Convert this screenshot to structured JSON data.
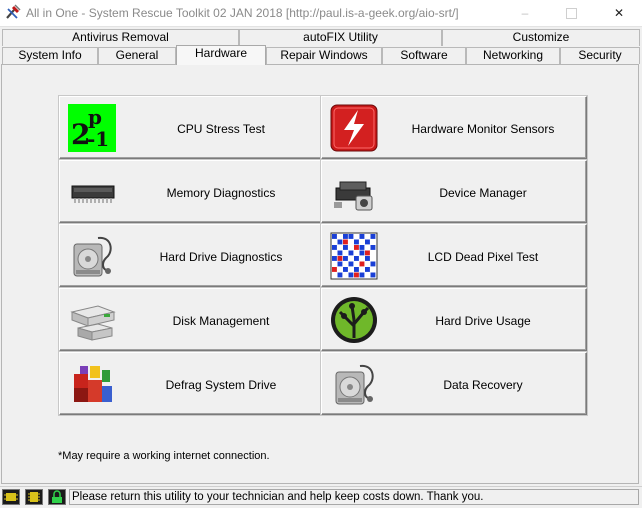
{
  "window": {
    "title": "All in One - System Rescue Toolkit 02 JAN 2018 [http://paul.is-a-geek.org/aio-srt/]",
    "controls": {
      "minimize": "–",
      "maximize": "",
      "close": "✕"
    }
  },
  "tabs": {
    "row1": [
      "Antivirus Removal",
      "autoFIX Utility",
      "Customize"
    ],
    "row2": [
      "System Info",
      "General",
      "Hardware",
      "Repair Windows",
      "Software",
      "Networking",
      "Security"
    ],
    "active": "Hardware"
  },
  "tools": {
    "left": [
      {
        "label": "CPU Stress Test",
        "icon": "cpu-stress-icon"
      },
      {
        "label": "Memory Diagnostics",
        "icon": "memory-chip-icon"
      },
      {
        "label": "Hard Drive Diagnostics",
        "icon": "hard-drive-stethoscope-icon"
      },
      {
        "label": "Disk Management",
        "icon": "disk-management-icon"
      },
      {
        "label": "Defrag System Drive",
        "icon": "defrag-icon"
      }
    ],
    "right": [
      {
        "label": "Hardware Monitor Sensors",
        "icon": "lightning-icon"
      },
      {
        "label": "Device Manager",
        "icon": "device-manager-icon"
      },
      {
        "label": "LCD Dead Pixel Test",
        "icon": "pixel-grid-icon"
      },
      {
        "label": "Hard Drive Usage",
        "icon": "tree-map-icon"
      },
      {
        "label": "Data Recovery",
        "icon": "data-recovery-icon"
      }
    ],
    "cpu_icon_text": {
      "base": "2",
      "exp": "p",
      "tail": "-1"
    }
  },
  "note": "*May require a working internet connection.",
  "statusbar": {
    "message": "Please return this utility to your technician and help keep costs down. Thank you."
  },
  "colors": {
    "accent_green": "#00ff00",
    "accent_red": "#c81818",
    "pixel_blue": "#1a3fd6",
    "pixel_red": "#e02020"
  }
}
